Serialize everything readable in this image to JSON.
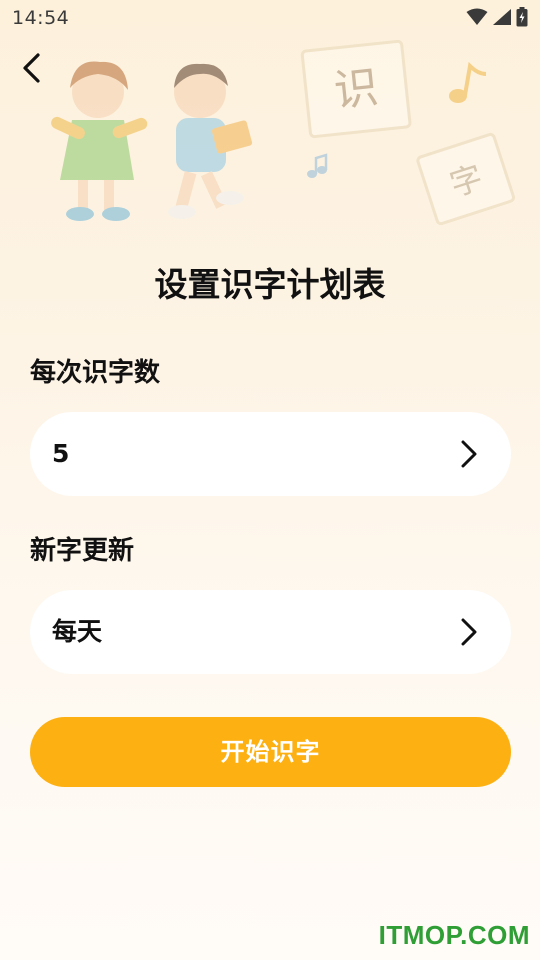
{
  "status_bar": {
    "time": "14:54"
  },
  "header": {
    "back_icon": "back-arrow-icon",
    "hero_chars": [
      "识",
      "字"
    ]
  },
  "title": "设置识字计划表",
  "daily_count": {
    "label": "每次识字数",
    "value": "5"
  },
  "update_frequency": {
    "label": "新字更新",
    "value": "每天"
  },
  "start_button": {
    "label": "开始识字",
    "color": "#fdb012"
  },
  "watermark": "ITMOP.COM",
  "colors": {
    "accent": "#fdb012",
    "background_top": "#fdf1dc",
    "background_bottom": "#fffbf7",
    "watermark": "#2e9e35"
  }
}
